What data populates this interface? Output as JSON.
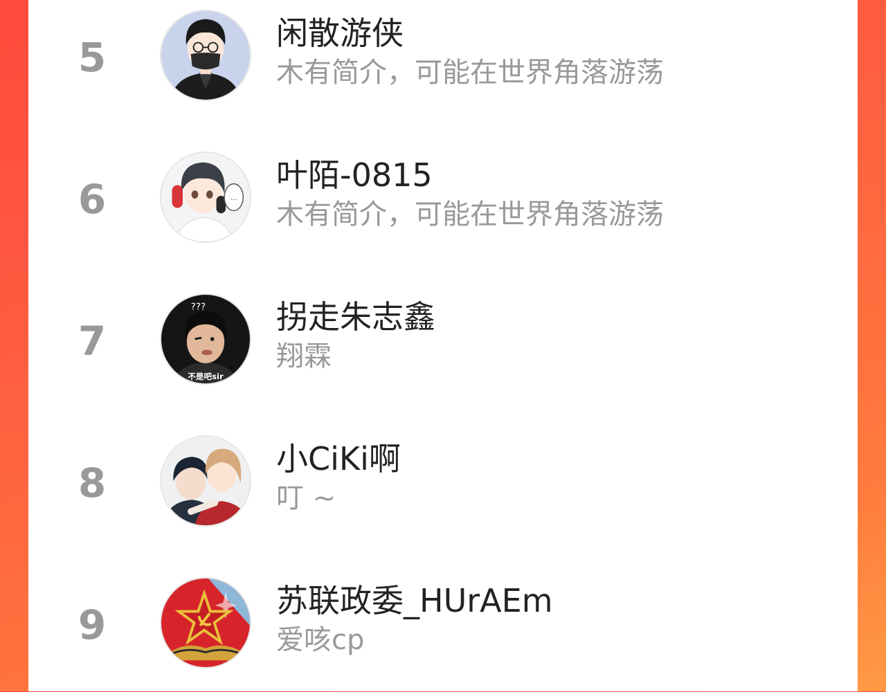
{
  "ranking": {
    "items": [
      {
        "rank": "5",
        "username": "闲散游侠",
        "bio": "木有简介，可能在世界角落游荡",
        "avatar_icon": "avatar-glasses-mask-boy"
      },
      {
        "rank": "6",
        "username": "叶陌-0815",
        "bio": "木有简介，可能在世界角落游荡",
        "avatar_icon": "avatar-anime-headphones-boy"
      },
      {
        "rank": "7",
        "username": "拐走朱志鑫",
        "bio": "翔霖",
        "avatar_icon": "avatar-photo-boy",
        "avatar_caption": "不是吧sir",
        "avatar_marks": "???"
      },
      {
        "rank": "8",
        "username": "小CiKi啊",
        "bio": "叮 ~",
        "avatar_icon": "avatar-anime-couple"
      },
      {
        "rank": "9",
        "username": "苏联政委_HUrAEm",
        "bio": "爱咳cp",
        "avatar_icon": "avatar-soviet-star"
      }
    ]
  },
  "colors": {
    "background_gradient_start": "#ff4a3c",
    "background_gradient_end": "#ff9a45",
    "panel": "#ffffff",
    "rank_number": "#999999",
    "username": "#222222",
    "bio": "#999999"
  }
}
